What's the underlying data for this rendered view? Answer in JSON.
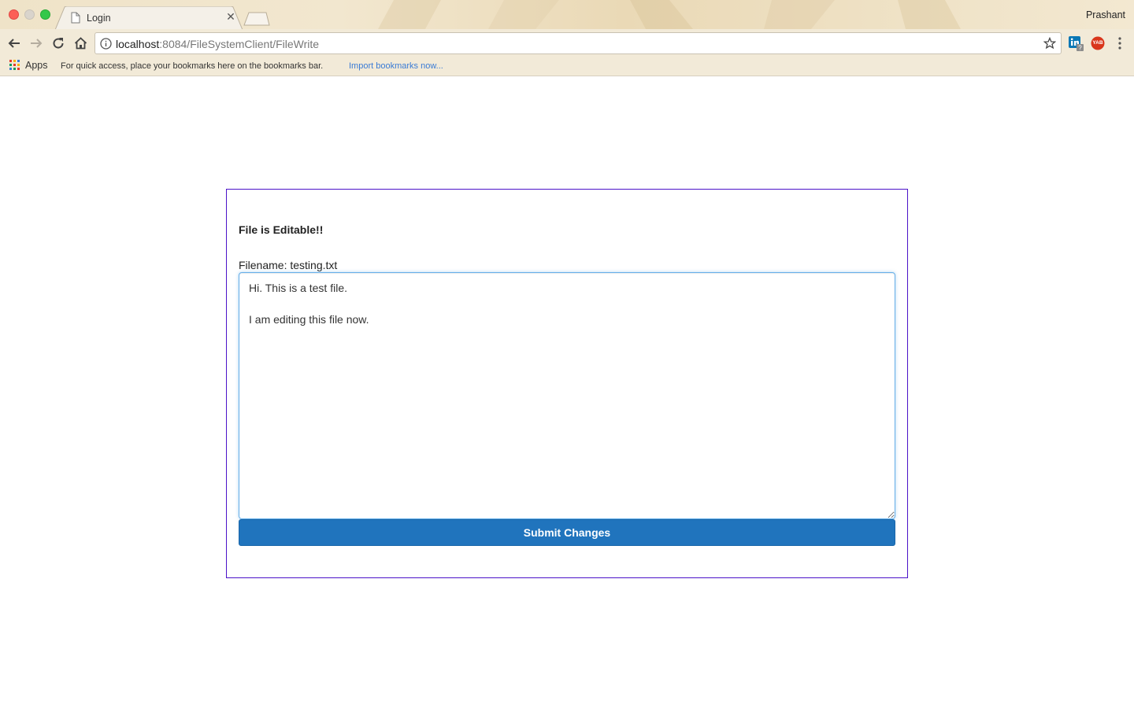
{
  "browser": {
    "tab_title": "Login",
    "profile_name": "Prashant",
    "url_host": "localhost",
    "url_rest": ":8084/FileSystemClient/FileWrite",
    "bookmarks": {
      "apps_label": "Apps",
      "hint": "For quick access, place your bookmarks here on the bookmarks bar.",
      "import_link": "Import bookmarks now..."
    },
    "extensions": [
      "linkedin-extension-icon",
      "yab-extension-icon"
    ],
    "extension_badge": "YAB"
  },
  "page": {
    "heading": "File is Editable!!",
    "filename_label": "Filename: testing.txt",
    "file_content": "Hi. This is a test file.\n\nI am editing this file now.",
    "submit_label": "Submit Changes"
  },
  "colors": {
    "panel_border": "#4b12c9",
    "submit_bg": "#2074bd",
    "textarea_focus": "#66afe9"
  }
}
